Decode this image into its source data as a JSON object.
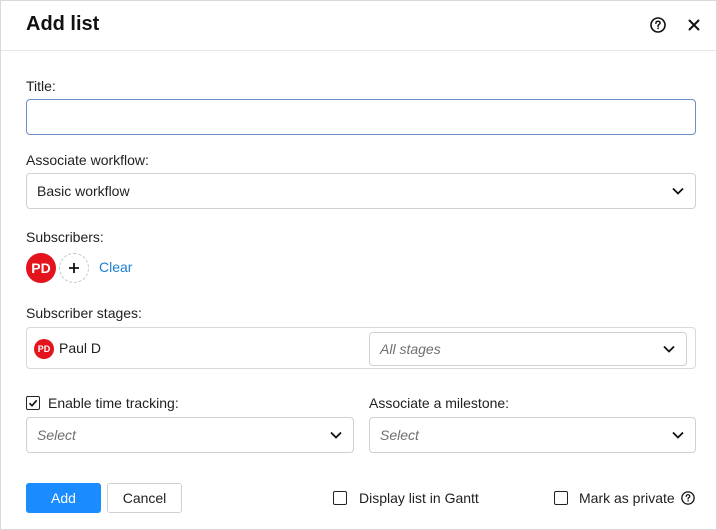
{
  "dialog": {
    "title": "Add list"
  },
  "form": {
    "title_label": "Title:",
    "title_value": "",
    "workflow_label": "Associate workflow:",
    "workflow_value": "Basic workflow",
    "subscribers_label": "Subscribers:",
    "subscribers": [
      {
        "initials": "PD",
        "name": "Paul D",
        "color": "#e3141b"
      }
    ],
    "clear_label": "Clear",
    "subscriber_stages_label": "Subscriber stages:",
    "stages_placeholder": "All stages",
    "time_tracking_label": "Enable time tracking:",
    "time_tracking_checked": true,
    "time_tracking_placeholder": "Select",
    "milestone_label": "Associate a milestone:",
    "milestone_placeholder": "Select",
    "gantt_label": "Display list in Gantt",
    "gantt_checked": false,
    "private_label": "Mark as private",
    "private_checked": false
  },
  "actions": {
    "add_label": "Add",
    "cancel_label": "Cancel"
  },
  "colors": {
    "primary": "#1a8cff",
    "link": "#1a7fd1",
    "avatar": "#e3141b",
    "focus_border": "#6b8fc4"
  },
  "icons": {
    "help": "help-circle-icon",
    "close": "close-icon",
    "chevron": "chevron-down-icon",
    "plus": "plus-icon",
    "check": "check-icon"
  }
}
